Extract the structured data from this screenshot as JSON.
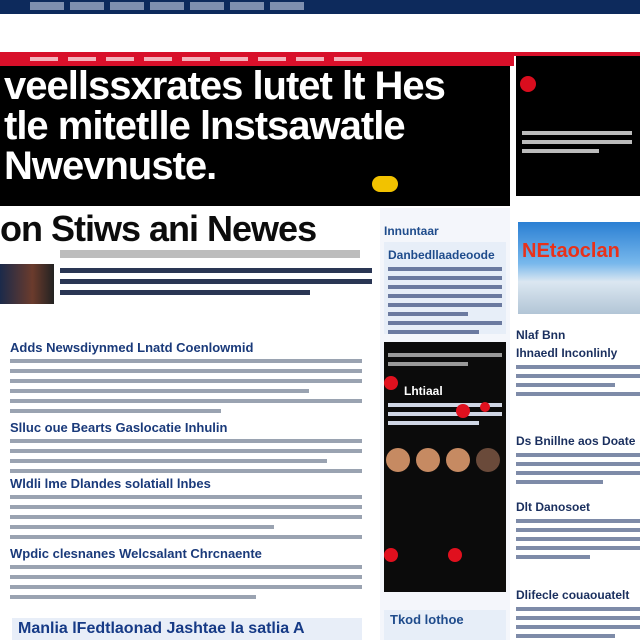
{
  "hero": {
    "headline_line1": "veellssxrates lutet lt Hes",
    "headline_line2": "tle mitetlle lnstsawatle",
    "headline_line3": "Nwevnuste."
  },
  "section_title": "on Stiws ani Newes",
  "articles": [
    {
      "heading": "Adds Newsdiynmed Lnatd Coenlowmid"
    },
    {
      "heading": "Slluc oue Bearts Gaslocatie Inhulin"
    },
    {
      "heading": "Wldli lme Dlandes solatiall lnbes"
    },
    {
      "heading": "Wpdic clesnanes Welcsalant Chrcnaente"
    }
  ],
  "bottom_banner": "Manlia lFedtlaonad Jashtae la satlia A",
  "middle_column": {
    "card1_title": "Innuntaar",
    "card2_title": "Danbedllaadeoode",
    "card3_title": "Lhtiaal",
    "card4_title": "Tkod lothoe"
  },
  "right_column": {
    "photo_overlay": "NEtaoclan",
    "block1_title": "Nlaf Bnn",
    "block2_title": "Ihnaedl Inconlinly",
    "block3_title": "Ds Bnillne aos Doate",
    "block4_title": "Dlt Danosoet",
    "block5_title": "Dlifecle couaouatelt"
  },
  "colors": {
    "brand_red": "#d8102a",
    "nav_blue": "#0d2a5c",
    "heading_blue": "#1a3a7a"
  }
}
